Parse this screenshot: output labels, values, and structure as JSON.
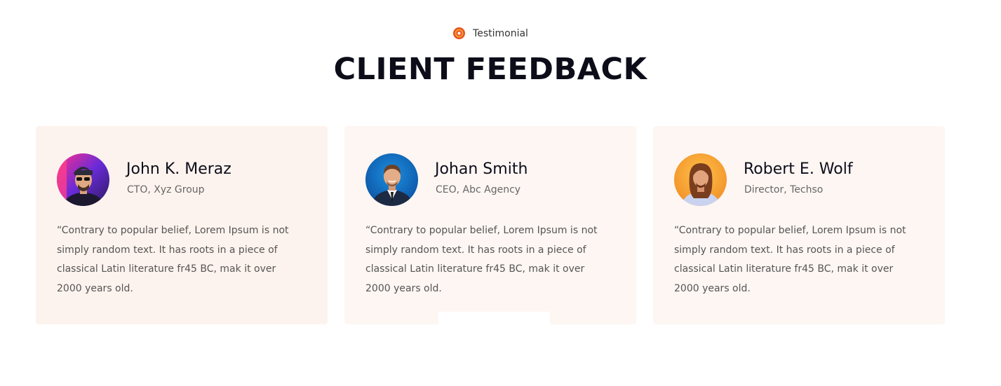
{
  "header": {
    "eyebrow": "Testimonial",
    "eyebrow_icon": "spiral-logo-icon",
    "title": "CLIENT FEEDBACK"
  },
  "colors": {
    "accent": "#e8541c",
    "card_bg": "#fdf3ee",
    "card_bg_light": "#fdf6f3",
    "heading": "#0d0d1a",
    "body_text": "#555555"
  },
  "testimonials": [
    {
      "name": "John K. Meraz",
      "role": "CTO, Xyz Group",
      "quote": "“Contrary to popular belief, Lorem Ipsum is not simply random text. It has roots in a piece of classical Latin literature fr45 BC, mak it over 2000 years old.",
      "avatar": "avatar-photo-man-cap-sunglasses"
    },
    {
      "name": "Johan Smith",
      "role": "CEO, Abc Agency",
      "quote": "“Contrary to popular belief, Lorem Ipsum is not simply random text. It has roots in a piece of classical Latin literature fr45 BC, mak it over 2000 years old.",
      "avatar": "avatar-photo-man-suit"
    },
    {
      "name": "Robert E. Wolf",
      "role": "Director, Techso",
      "quote": "“Contrary to popular belief, Lorem Ipsum is not simply random text. It has roots in a piece of classical Latin literature fr45 BC, mak it over 2000 years old.",
      "avatar": "avatar-photo-man-long-hair"
    }
  ]
}
